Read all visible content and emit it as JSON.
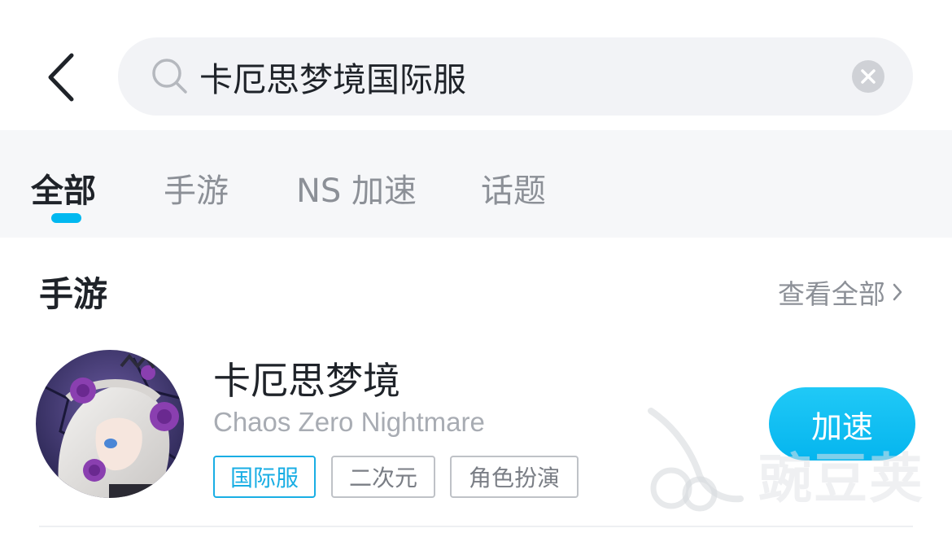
{
  "search": {
    "query": "卡厄思梦境国际服"
  },
  "tabs": [
    {
      "label": "全部",
      "active": true
    },
    {
      "label": "手游",
      "active": false
    },
    {
      "label": "NS 加速",
      "active": false
    },
    {
      "label": "话题",
      "active": false
    }
  ],
  "section": {
    "title": "手游",
    "view_all": "查看全部"
  },
  "game": {
    "name": "卡厄思梦境",
    "english_name": "Chaos Zero Nightmare",
    "tags": [
      "国际服",
      "二次元",
      "角色扮演"
    ],
    "action_label": "加速"
  },
  "watermark": {
    "text": "豌豆荚"
  },
  "colors": {
    "accent": "#00b8f0",
    "button": "#08b7ef",
    "tag_primary": "#19aee4",
    "search_bg": "#f2f3f6",
    "tabs_bg": "#f6f7f9"
  }
}
